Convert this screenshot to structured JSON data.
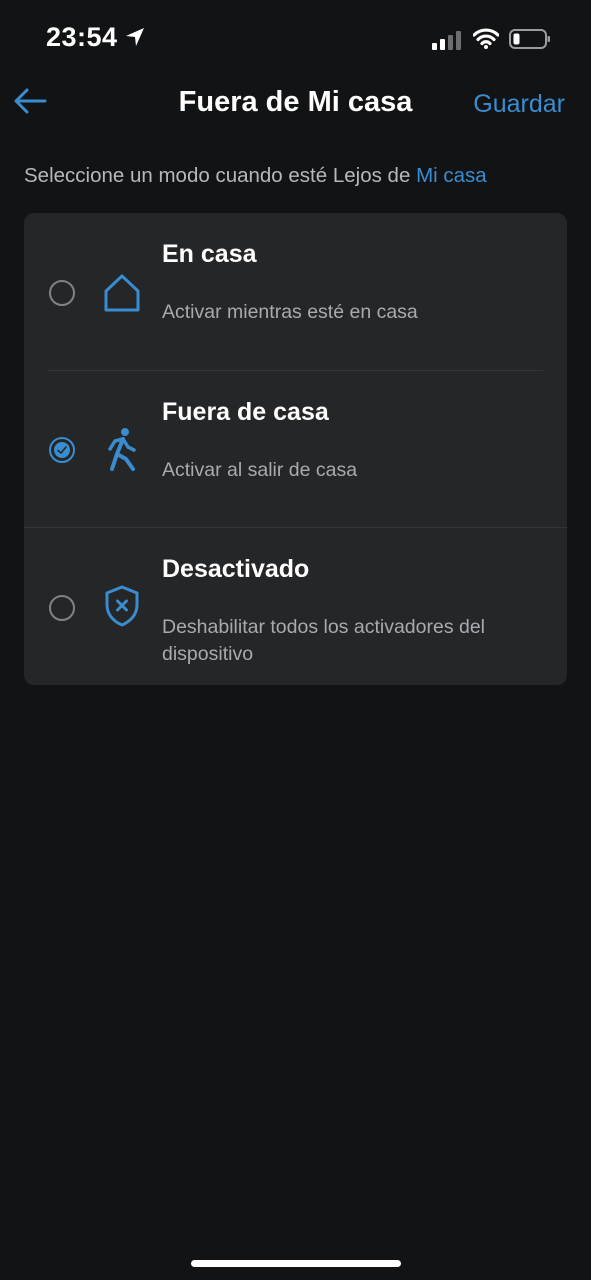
{
  "status_bar": {
    "time": "23:54"
  },
  "nav": {
    "title": "Fuera de Mi casa",
    "save_label": "Guardar"
  },
  "subtitle": {
    "text": "Seleccione un modo cuando esté Lejos de ",
    "link": "Mi casa"
  },
  "options": [
    {
      "title": "En casa",
      "description": "Activar mientras esté en casa",
      "icon": "house-icon",
      "selected": false
    },
    {
      "title": "Fuera de casa",
      "description": "Activar al salir de casa",
      "icon": "walking-person-icon",
      "selected": true
    },
    {
      "title": "Desactivado",
      "description": "Deshabilitar todos los activadores del dispositivo",
      "icon": "shield-x-icon",
      "selected": false
    }
  ],
  "colors": {
    "accent": "#3a8cd0",
    "background": "#121314",
    "card": "#242628"
  }
}
